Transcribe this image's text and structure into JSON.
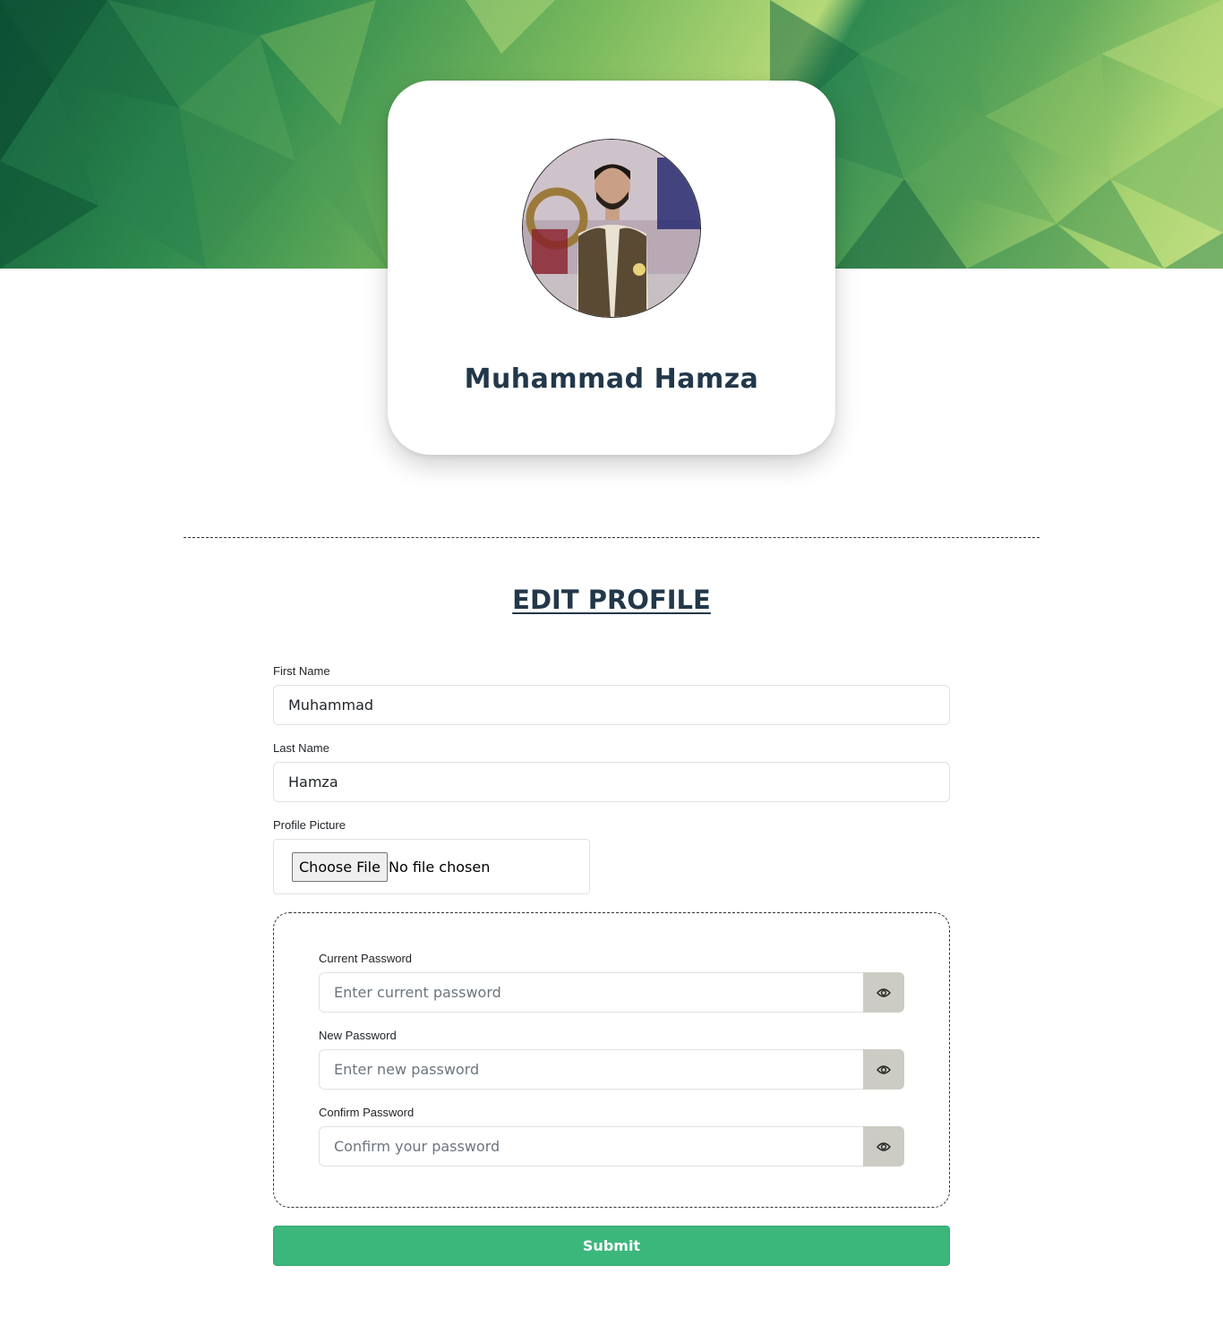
{
  "profile": {
    "display_name": "Muhammad Hamza"
  },
  "form": {
    "title": "EDIT PROFILE",
    "first_name": {
      "label": "First Name",
      "value": "Muhammad"
    },
    "last_name": {
      "label": "Last Name",
      "value": "Hamza"
    },
    "profile_picture": {
      "label": "Profile Picture",
      "button_label": "Choose File",
      "status": "No file chosen"
    },
    "current_password": {
      "label": "Current Password",
      "placeholder": "Enter current password",
      "icon": "eye-icon"
    },
    "new_password": {
      "label": "New Password",
      "placeholder": "Enter new password",
      "icon": "eye-icon"
    },
    "confirm_password": {
      "label": "Confirm Password",
      "placeholder": "Confirm your password",
      "icon": "eye-icon"
    },
    "submit_label": "Submit"
  },
  "colors": {
    "heading": "#22384a",
    "submit": "#3cb77c",
    "eye_button": "#ccccc4",
    "banner_dark": "#0f5a3a",
    "banner_light": "#b6d978"
  }
}
